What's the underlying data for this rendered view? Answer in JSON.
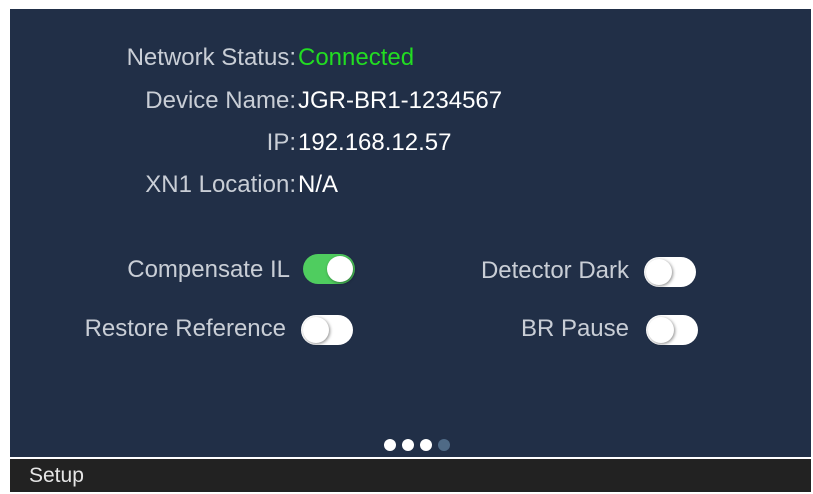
{
  "info": {
    "network_status_label": "Network Status:",
    "network_status_value": "Connected",
    "device_name_label": "Device Name:",
    "device_name_value": "JGR-BR1-1234567",
    "ip_label": "IP:",
    "ip_value": "192.168.12.57",
    "xn1_location_label": "XN1 Location:",
    "xn1_location_value": "N/A"
  },
  "toggles": {
    "compensate_il": {
      "label": "Compensate IL",
      "state": "on"
    },
    "detector_dark": {
      "label": "Detector Dark",
      "state": "off"
    },
    "restore_reference": {
      "label": "Restore Reference",
      "state": "off"
    },
    "br_pause": {
      "label": "BR Pause",
      "state": "off"
    }
  },
  "pager": {
    "total_pages": 4,
    "current_page": 3
  },
  "statusbar": {
    "title": "Setup"
  },
  "colors": {
    "screen_background": "#212f47",
    "connected": "#22dd22",
    "toggle_on": "#4fcd5f",
    "toggle_off": "#ffffff",
    "statusbar_background": "#222222"
  }
}
